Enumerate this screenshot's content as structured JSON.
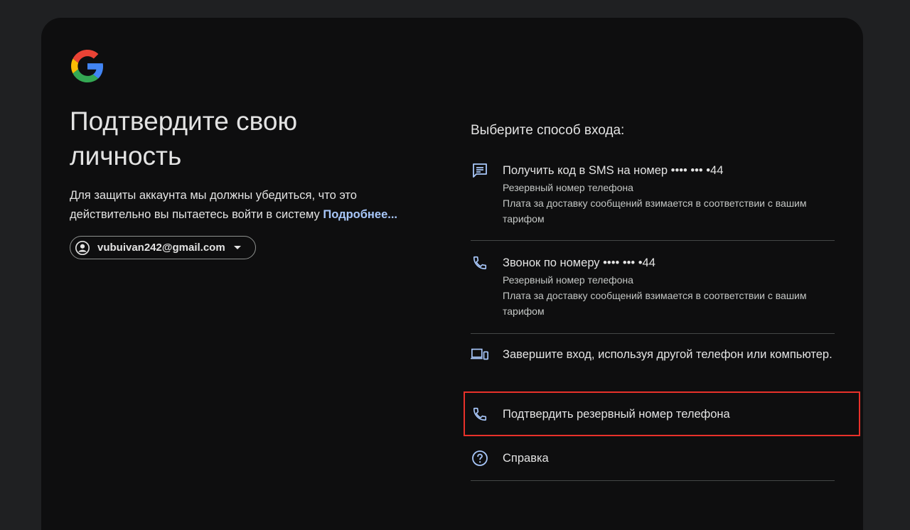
{
  "logo": {
    "icon": "google-logo"
  },
  "heading": {
    "title": "Подтвердите свою личность",
    "subtitle": "Для защиты аккаунта мы должны убедиться, что это действительно вы пытаетесь войти в систему",
    "learn_more": "Подробнее..."
  },
  "account": {
    "email": "vubuivan242@gmail.com",
    "icon": "account-circle-icon"
  },
  "choose": {
    "heading": "Выберите способ входа:"
  },
  "options": [
    {
      "icon": "sms-icon",
      "label": "Получить код в SMS на номер •••• ••• •44",
      "desc1": "Резервный номер телефона",
      "desc2": "Плата за доставку сообщений взимается в соответствии с вашим тарифом"
    },
    {
      "icon": "phone-icon",
      "label": "Звонок по номеру •••• ••• •44",
      "desc1": "Резервный номер телефона",
      "desc2": "Плата за доставку сообщений взимается в соответствии с вашим тарифом"
    },
    {
      "icon": "devices-icon",
      "label": "Завершите вход, используя другой телефон или компьютер."
    },
    {
      "icon": "phone-icon",
      "label": "Подтвердить резервный номер телефона"
    },
    {
      "icon": "help-icon",
      "label": "Справка"
    }
  ],
  "colors": {
    "background": "#1f2022",
    "card": "#0e0e0f",
    "text": "#e3e3e3",
    "secondary_text": "#c4c7c5",
    "link": "#a8c7fa",
    "icon": "#a8c7fa",
    "highlight": "#e8312a"
  }
}
